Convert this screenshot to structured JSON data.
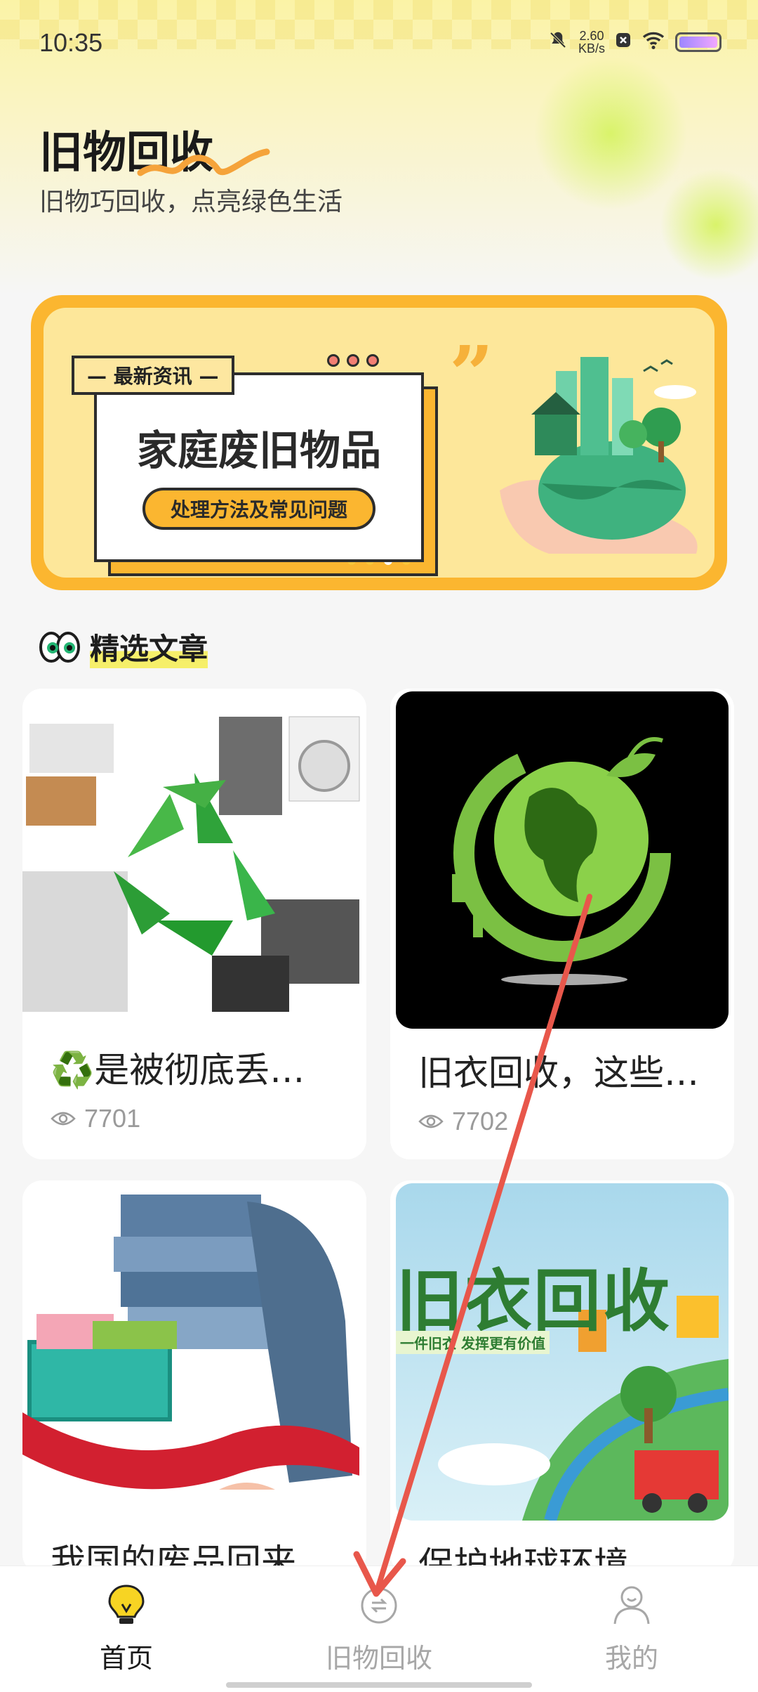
{
  "status": {
    "time": "10:35",
    "speed_value": "2.60",
    "speed_unit": "KB/s"
  },
  "header": {
    "title": "旧物回收",
    "subtitle": "旧物巧回收，点亮绿色生活"
  },
  "banner": {
    "tag": "— 最新资讯 —",
    "title": "家庭废旧物品",
    "pill": "处理方法及常见问题",
    "quote": "”"
  },
  "section": {
    "title": "精选文章"
  },
  "articles": [
    {
      "title": "♻️是被彻底丢弃…",
      "views": "7701"
    },
    {
      "title": "旧衣回收，这些…",
      "views": "7702"
    },
    {
      "title": "我国的废品回来…",
      "views": ""
    },
    {
      "title": "保护地球环境，…",
      "views": ""
    }
  ],
  "thumb_text": {
    "recycle_art": "旧衣回收",
    "recycle_sub": "一件旧衣 发挥更有价值"
  },
  "tabbar": {
    "items": [
      {
        "label": "首页",
        "icon": "lightbulb-icon",
        "active": true
      },
      {
        "label": "旧物回收",
        "icon": "exchange-icon",
        "active": false
      },
      {
        "label": "我的",
        "icon": "user-icon",
        "active": false
      }
    ]
  },
  "colors": {
    "accent": "#fbb630",
    "active_tab": "#1a1a1a",
    "inactive_tab": "#a7a7a7",
    "annotation_arrow": "#e8574b"
  }
}
